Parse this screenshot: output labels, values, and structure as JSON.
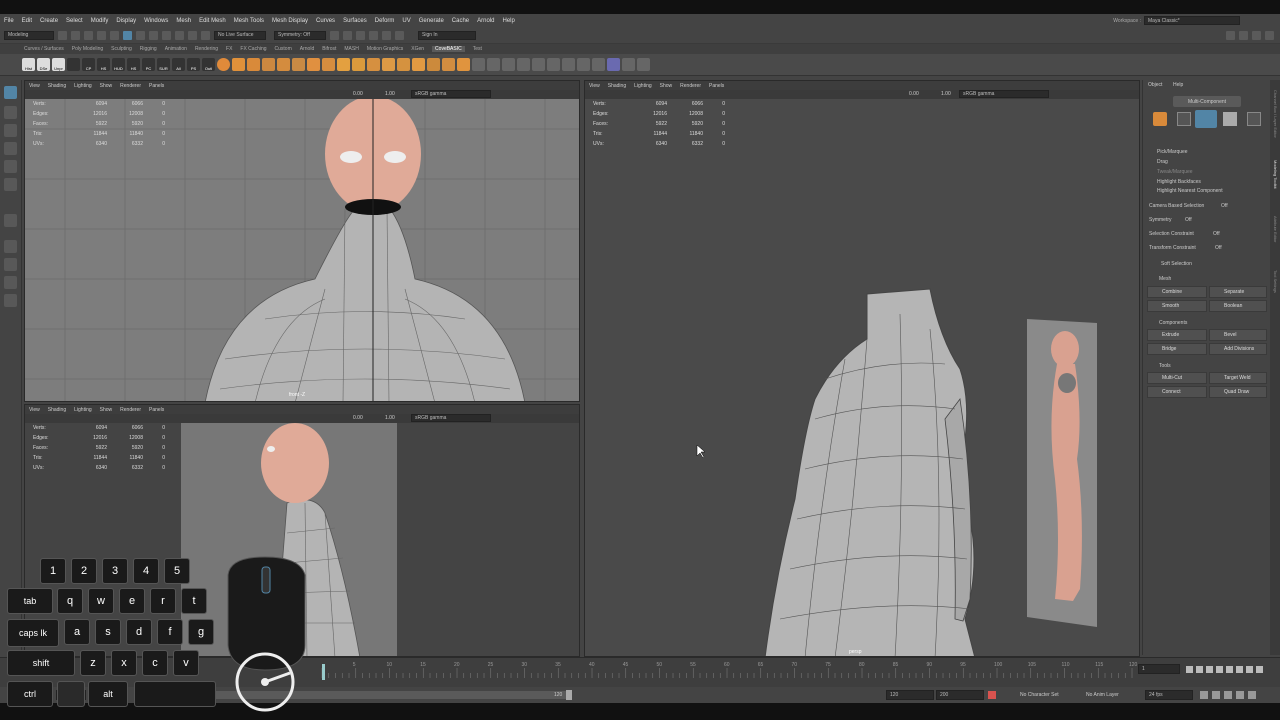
{
  "menus": [
    "File",
    "Edit",
    "Create",
    "Select",
    "Modify",
    "Display",
    "Windows",
    "Mesh",
    "Edit Mesh",
    "Mesh Tools",
    "Mesh Display",
    "Curves",
    "Surfaces",
    "Deform",
    "UV",
    "Generate",
    "Cache",
    "Arnold",
    "Help"
  ],
  "workspace": {
    "label": "Workspace :",
    "value": "Maya Classic*"
  },
  "status": {
    "mode": "Modeling",
    "live_surface": "No Live Surface",
    "symmetry": "Symmetry: Off",
    "signin": "Sign In"
  },
  "shelf_tabs": [
    "Curves / Surfaces",
    "Poly Modeling",
    "Sculpting",
    "Rigging",
    "Animation",
    "Rendering",
    "FX",
    "FX Caching",
    "Custom",
    "Arnold",
    "Bifrost",
    "MASH",
    "Motion Graphics",
    "XGen",
    "CoveBASIC",
    "Test"
  ],
  "shelf_icons": [
    "Hist",
    "DSe",
    "Unpr",
    "",
    "CP",
    "HS",
    "HUD",
    "HS",
    "PC",
    "SUR",
    "All",
    "PS",
    "Outl"
  ],
  "viewport_menu": [
    "View",
    "Shading",
    "Lighting",
    "Show",
    "Renderer",
    "Panels"
  ],
  "viewport_tool": {
    "val1": "0.00",
    "val2": "1.00",
    "colorspace": "sRGB gamma"
  },
  "hud": {
    "rows": [
      {
        "label": "Verts:",
        "a": "6094",
        "b": "6066",
        "c": "0"
      },
      {
        "label": "Edges:",
        "a": "12016",
        "b": "12008",
        "c": "0"
      },
      {
        "label": "Faces:",
        "a": "5922",
        "b": "5920",
        "c": "0"
      },
      {
        "label": "Tris:",
        "a": "11844",
        "b": "11840",
        "c": "0"
      },
      {
        "label": "UVs:",
        "a": "6340",
        "b": "6332",
        "c": "0"
      }
    ]
  },
  "front_label": "front -Z",
  "persp_label": "persp",
  "attr_panel": {
    "menu": [
      "Object",
      "Help"
    ],
    "title": "Multi-Component",
    "pick": "Pick/Marquee",
    "drag": "Drag",
    "tweak": "Tweak/Marquee",
    "backfaces": "Highlight Backfaces",
    "nearest": "Highlight Nearest Component",
    "camera_sel": "Camera Based Selection",
    "symmetry": "Symmetry",
    "sel_constraint": "Selection Constraint",
    "xform_constraint": "Transform Constraint",
    "off": "Off",
    "soft_sel": "Soft Selection",
    "mesh": "Mesh",
    "combine": "Combine",
    "separate": "Separate",
    "smooth": "Smooth",
    "boolean": "Boolean",
    "components": "Components",
    "extrude": "Extrude",
    "bevel": "Bevel",
    "bridge": "Bridge",
    "add_div": "Add Divisions",
    "tools": "Tools",
    "multicut": "Multi-Cut",
    "target_weld": "Target Weld",
    "connect": "Connect",
    "quad_draw": "Quad Draw"
  },
  "side_tabs": [
    "Channel Box / Layer Editor",
    "Modeling Toolkit",
    "Attribute Editor",
    "Tool Settings"
  ],
  "timeline": {
    "ticks": [
      "5",
      "10",
      "15",
      "20",
      "25",
      "30",
      "35",
      "40",
      "45",
      "50",
      "55",
      "60",
      "65",
      "70",
      "75",
      "80",
      "85",
      "90",
      "95",
      "100",
      "105",
      "110",
      "115",
      "120"
    ],
    "frame": "1"
  },
  "range": {
    "start": "1",
    "start2": "1",
    "end_handle": "120",
    "end": "120",
    "end2": "200",
    "char_set": "No Character Set",
    "anim_layer": "No Anim Layer",
    "fps": "24 fps"
  },
  "keys": {
    "row1": [
      "1",
      "2",
      "3",
      "4",
      "5"
    ],
    "row2": [
      "tab",
      "q",
      "w",
      "e",
      "r",
      "t"
    ],
    "row3": [
      "caps lk",
      "a",
      "s",
      "d",
      "f",
      "g"
    ],
    "row4": [
      "shift",
      "z",
      "x",
      "c",
      "v"
    ],
    "row5": [
      "ctrl",
      "alt"
    ]
  },
  "colors": {
    "accent": "#5285a6",
    "skin": "#d9a190",
    "mesh": "#b0b0b0"
  }
}
